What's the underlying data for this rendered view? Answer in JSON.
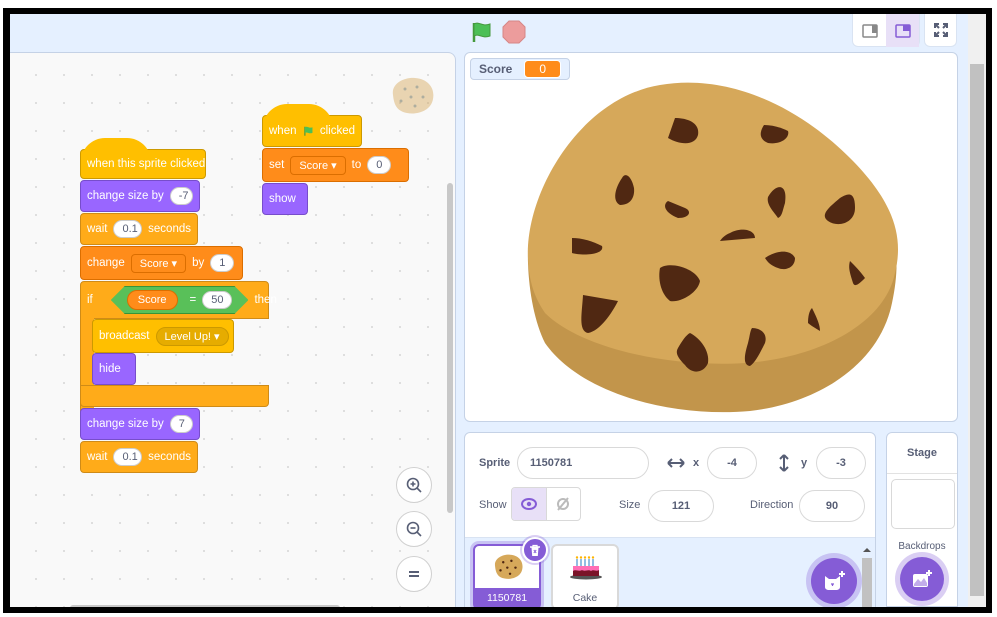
{
  "toolbar": {
    "green_flag": "green-flag",
    "stop": "stop-sign",
    "layout_modes": [
      "small-stage",
      "normal-stage"
    ],
    "active_layout": "normal-stage",
    "fullscreen": "fullscreen"
  },
  "scripts": {
    "script1": {
      "hat": "when this sprite clicked",
      "change_size_1": {
        "label": "change size by",
        "value": "-7"
      },
      "wait_1": {
        "label": "wait",
        "value": "0.1",
        "unit": "seconds"
      },
      "change_var": {
        "label": "change",
        "var": "Score",
        "by": "by",
        "value": "1"
      },
      "if_block": {
        "label": "if",
        "then": "then",
        "cond_var": "Score",
        "op": "=",
        "cond_value": "50"
      },
      "broadcast": {
        "label": "broadcast",
        "message": "Level Up!"
      },
      "hide": "hide",
      "change_size_2": {
        "label": "change size by",
        "value": "7"
      },
      "wait_2": {
        "label": "wait",
        "value": "0.1",
        "unit": "seconds"
      }
    },
    "script2": {
      "hat_when": "when",
      "hat_clicked": "clicked",
      "set_var": {
        "label": "set",
        "var": "Score",
        "to": "to",
        "value": "0"
      },
      "show": "show"
    }
  },
  "zoom_controls": [
    "zoom-in",
    "zoom-out",
    "reset-zoom"
  ],
  "stage": {
    "monitor": {
      "label": "Score",
      "value": "0"
    },
    "sprite": "cookie"
  },
  "sprite_info": {
    "sprite_label": "Sprite",
    "sprite_name": "1150781",
    "x_label": "x",
    "x_value": "-4",
    "y_label": "y",
    "y_value": "-3",
    "show_label": "Show",
    "size_label": "Size",
    "size_value": "121",
    "direction_label": "Direction",
    "direction_value": "90"
  },
  "sprites": [
    {
      "name": "1150781",
      "selected": true
    },
    {
      "name": "Cake",
      "selected": false
    }
  ],
  "stage_panel": {
    "title": "Stage",
    "backdrops_label": "Backdrops"
  },
  "colors": {
    "events": "#ffbf00",
    "looks": "#9966ff",
    "control": "#ffab19",
    "variables": "#ff8c1a",
    "operators": "#59c059",
    "accent": "#855cd6"
  }
}
